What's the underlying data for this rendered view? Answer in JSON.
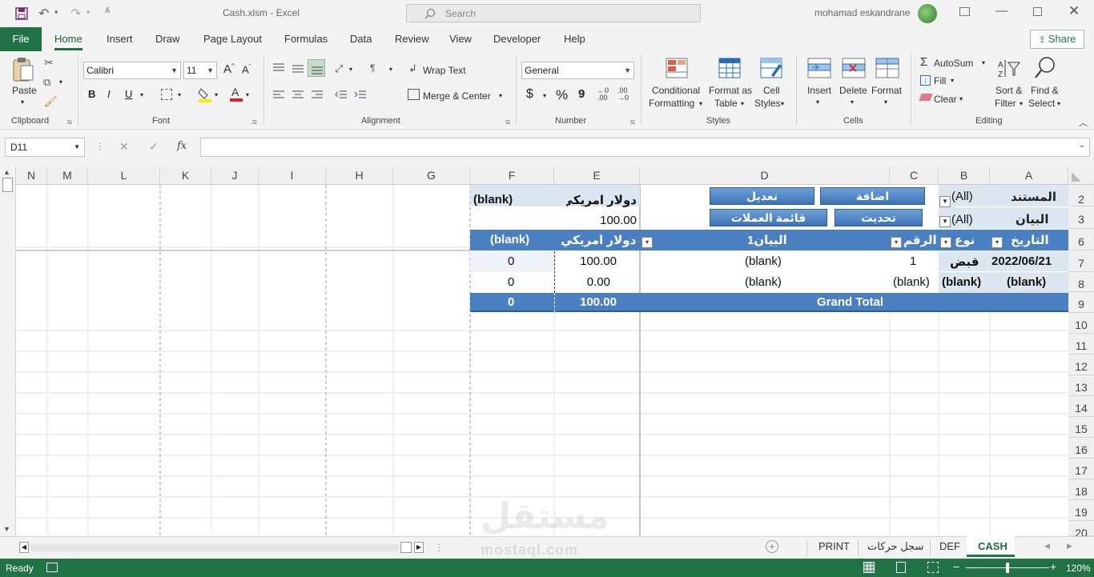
{
  "titlebar": {
    "file_title": "Cash.xlsm  -  Excel",
    "search_placeholder": "Search",
    "user_name": "mohamad eskandrane"
  },
  "ribbon_tabs": [
    "File",
    "Home",
    "Insert",
    "Draw",
    "Page Layout",
    "Formulas",
    "Data",
    "Review",
    "View",
    "Developer",
    "Help"
  ],
  "active_tab": "Home",
  "share_label": "Share",
  "clipboard": {
    "paste": "Paste",
    "group": "Clipboard"
  },
  "font": {
    "name": "Calibri",
    "size": "11",
    "group": "Font",
    "bold": "B",
    "italic": "I",
    "underline": "U"
  },
  "alignment": {
    "wrap": "Wrap Text",
    "merge": "Merge & Center",
    "group": "Alignment"
  },
  "number": {
    "format": "General",
    "currency": "$",
    "percent": "%",
    "comma": "9",
    "group": "Number"
  },
  "styles": {
    "conditional": [
      "Conditional",
      "Formatting"
    ],
    "format_table": [
      "Format as",
      "Table"
    ],
    "cell_styles": [
      "Cell",
      "Styles"
    ],
    "group": "Styles"
  },
  "cells": {
    "insert": "Insert",
    "delete": "Delete",
    "format": "Format",
    "group": "Cells"
  },
  "editing": {
    "autosum": "AutoSum",
    "fill": "Fill",
    "clear": "Clear",
    "sort": [
      "Sort &",
      "Filter"
    ],
    "find": [
      "Find &",
      "Select"
    ],
    "group": "Editing"
  },
  "formula_bar": {
    "name_box": "D11",
    "fx": "fx",
    "formula": ""
  },
  "columns": [
    "N",
    "M",
    "L",
    "K",
    "J",
    "I",
    "H",
    "G",
    "F",
    "E",
    "D",
    "C",
    "B",
    "A"
  ],
  "rows": [
    "2",
    "3",
    "6",
    "7",
    "8",
    "9",
    "10",
    "11",
    "12",
    "13",
    "14",
    "15",
    "16",
    "17",
    "18",
    "19",
    "20"
  ],
  "filters": {
    "document_label": "المستند",
    "document_value": "(All)",
    "statement_label": "البيان",
    "statement_value": "(All)"
  },
  "macro_buttons": {
    "edit": "تعديل",
    "add": "اضافة",
    "currencies": "قائمة العملات",
    "update": "تحديث"
  },
  "pivot": {
    "col_header_currency": "دولار امريكي",
    "col_header_blank": "(blank)",
    "subheader_value": "100.00",
    "headers": {
      "date": "التاريخ",
      "type": "نوع",
      "number": "الرقم",
      "statement": "البيان1",
      "usd": "دولار امريكي",
      "blank": "(blank)"
    },
    "rows": [
      {
        "date": "2022/06/21",
        "type": "قبض",
        "number": "1",
        "statement": "(blank)",
        "usd": "100.00",
        "blank": "0"
      },
      {
        "date": "(blank)",
        "type": "(blank)",
        "number": "(blank)",
        "statement": "(blank)",
        "usd": "0.00",
        "blank": "0"
      }
    ],
    "grand_total": {
      "label": "Grand Total",
      "usd": "100.00",
      "blank": "0"
    }
  },
  "sheet_tabs": [
    "PRINT",
    "سجل حركات",
    "DEF",
    "CASH"
  ],
  "active_sheet": "CASH",
  "status": {
    "ready": "Ready",
    "zoom": "120%"
  },
  "watermark": {
    "brand": "مستقل",
    "url": "mostaql.com"
  },
  "colors": {
    "excel_green": "#217346",
    "pivot_blue": "#4a7fc1",
    "pivot_light": "#dce6f1"
  }
}
